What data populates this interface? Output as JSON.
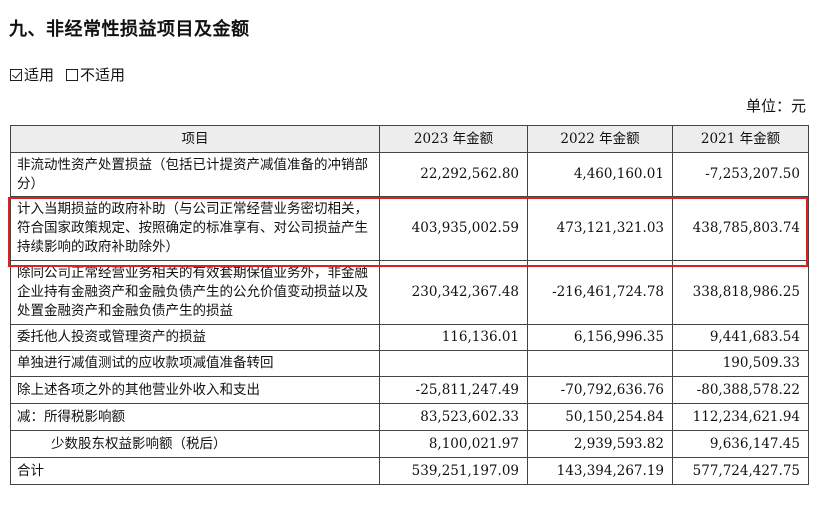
{
  "section_title": "九、非经常性损益项目及金额",
  "applicability": {
    "applicable_label": "适用",
    "not_applicable_label": "不适用",
    "applicable_checked": true
  },
  "unit_label": "单位：元",
  "table": {
    "headers": [
      "项目",
      "2023 年金额",
      "2022 年金额",
      "2021 年金额"
    ],
    "rows": [
      {
        "item": "非流动性资产处置损益（包括已计提资产减值准备的冲销部分）",
        "y2023": "22,292,562.80",
        "y2022": "4,460,160.01",
        "y2021": "-7,253,207.50"
      },
      {
        "item": "计入当期损益的政府补助（与公司正常经营业务密切相关，符合国家政策规定、按照确定的标准享有、对公司损益产生持续影响的政府补助除外）",
        "y2023": "403,935,002.59",
        "y2022": "473,121,321.03",
        "y2021": "438,785,803.74"
      },
      {
        "item": "除同公司正常经营业务相关的有效套期保值业务外，非金融企业持有金融资产和金融负债产生的公允价值变动损益以及处置金融资产和金融负债产生的损益",
        "y2023": "230,342,367.48",
        "y2022": "-216,461,724.78",
        "y2021": "338,818,986.25"
      },
      {
        "item": "委托他人投资或管理资产的损益",
        "y2023": "116,136.01",
        "y2022": "6,156,996.35",
        "y2021": "9,441,683.54"
      },
      {
        "item": "单独进行减值测试的应收款项减值准备转回",
        "y2023": "",
        "y2022": "",
        "y2021": "190,509.33"
      },
      {
        "item": "除上述各项之外的其他营业外收入和支出",
        "y2023": "-25,811,247.49",
        "y2022": "-70,792,636.76",
        "y2021": "-80,388,578.22"
      },
      {
        "item": "减：所得税影响额",
        "y2023": "83,523,602.33",
        "y2022": "50,150,254.84",
        "y2021": "112,234,621.94"
      },
      {
        "item": "少数股东权益影响额（税后）",
        "y2023": "8,100,021.97",
        "y2022": "2,939,593.82",
        "y2021": "9,636,147.45"
      },
      {
        "item": "合计",
        "y2023": "539,251,197.09",
        "y2022": "143,394,267.19",
        "y2021": "577,724,427.75"
      }
    ]
  },
  "colors": {
    "highlight_border": "#e02020",
    "header_background": "#ededed"
  }
}
